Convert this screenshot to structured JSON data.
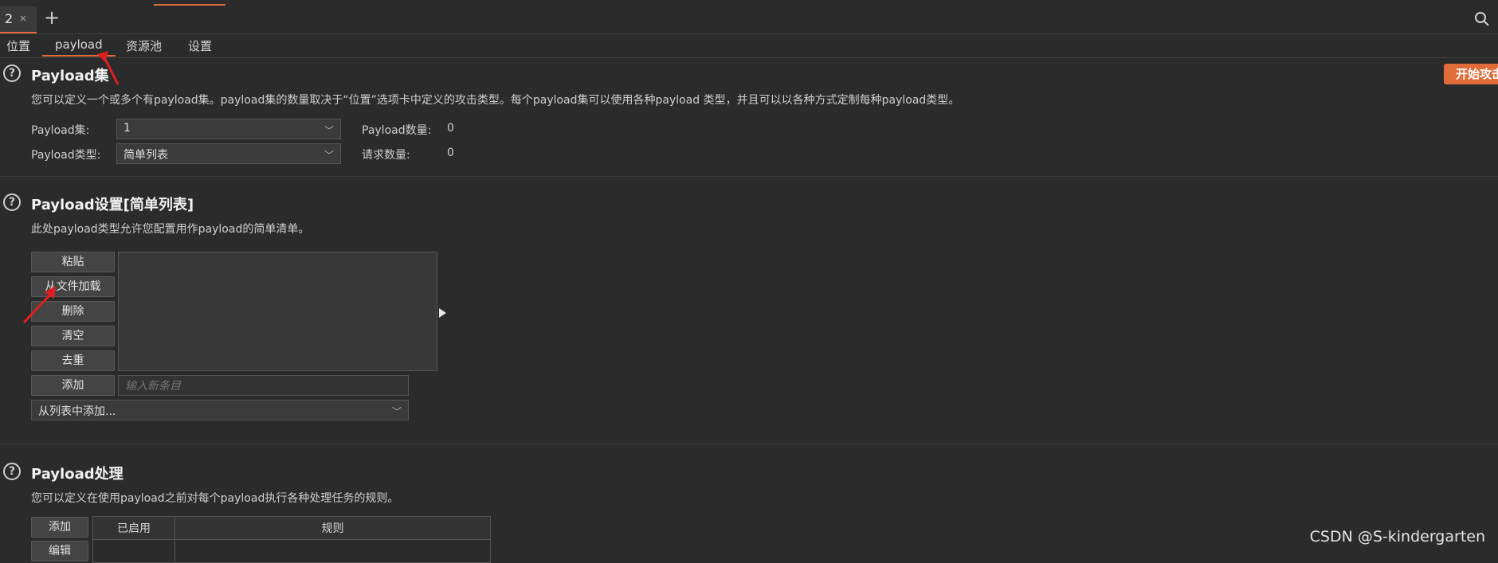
{
  "tabs": {
    "active_tab": "2",
    "close": "×",
    "new_tab": "+"
  },
  "subtabs": [
    "位置",
    "payload",
    "资源池",
    "设置"
  ],
  "accent_color": "#e06c3a",
  "payload_sets": {
    "title": "Payload集",
    "start_button": "开始攻击",
    "description": "您可以定义一个或多个有payload集。payload集的数量取决于“位置”选项卡中定义的攻击类型。每个payload集可以使用各种payload 类型，并且可以以各种方式定制每种payload类型。",
    "set_label": "Payload集:",
    "set_value": "1",
    "type_label": "Payload类型:",
    "type_value": "简单列表",
    "count_label": "Payload数量:",
    "count_value": "0",
    "request_label": "请求数量:",
    "request_value": "0"
  },
  "payload_settings": {
    "title": "Payload设置[简单列表]",
    "description": "此处payload类型允许您配置用作payload的简单清单。",
    "buttons": [
      "粘贴",
      "从文件加载",
      "删除",
      "清空",
      "去重"
    ],
    "add_button": "添加",
    "new_item_placeholder": "输入新条目",
    "add_from_list": "从列表中添加..."
  },
  "payload_processing": {
    "title": "Payload处理",
    "description": "您可以定义在使用payload之前对每个payload执行各种处理任务的规则。",
    "add_button": "添加",
    "edit_button": "编辑",
    "columns": [
      "已启用",
      "规则"
    ]
  },
  "watermark": "CSDN @S-kindergarten"
}
